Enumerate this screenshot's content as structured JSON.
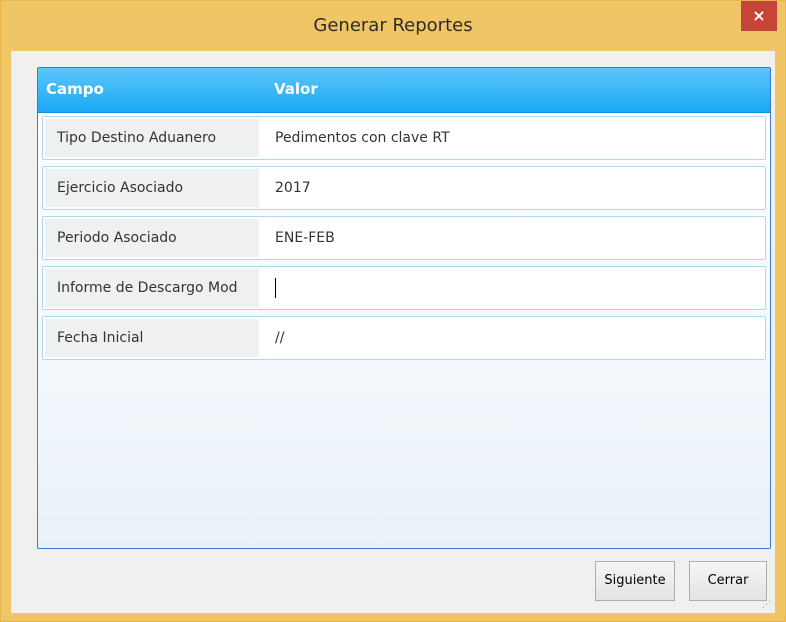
{
  "window": {
    "title": "Generar Reportes",
    "close_glyph": "×"
  },
  "grid": {
    "columns": [
      "Campo",
      "Valor"
    ],
    "rows": [
      {
        "field": "Tipo Destino Aduanero",
        "value": "Pedimentos con clave RT"
      },
      {
        "field": "Ejercicio Asociado",
        "value": "2017"
      },
      {
        "field": "Periodo Asociado",
        "value": "ENE-FEB"
      },
      {
        "field": "Informe de Descargo Mod",
        "value": ""
      },
      {
        "field": "Fecha Inicial",
        "value": "//"
      }
    ]
  },
  "buttons": {
    "next": "Siguiente",
    "close": "Cerrar"
  },
  "colors": {
    "titlebar": "#f0c566",
    "header": "#1aa9f5",
    "close": "#c7443a"
  }
}
